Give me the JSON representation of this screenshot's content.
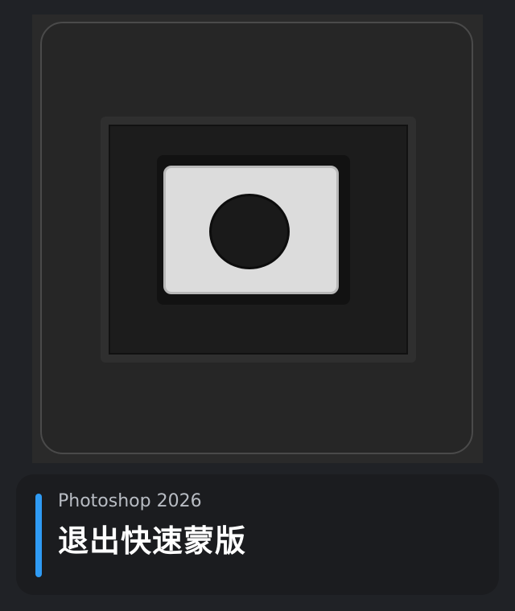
{
  "icon": {
    "name": "quick-mask-icon"
  },
  "caption": {
    "app": "Photoshop 2026",
    "command": "退出快速蒙版",
    "accent_color": "#2f9bf4"
  }
}
